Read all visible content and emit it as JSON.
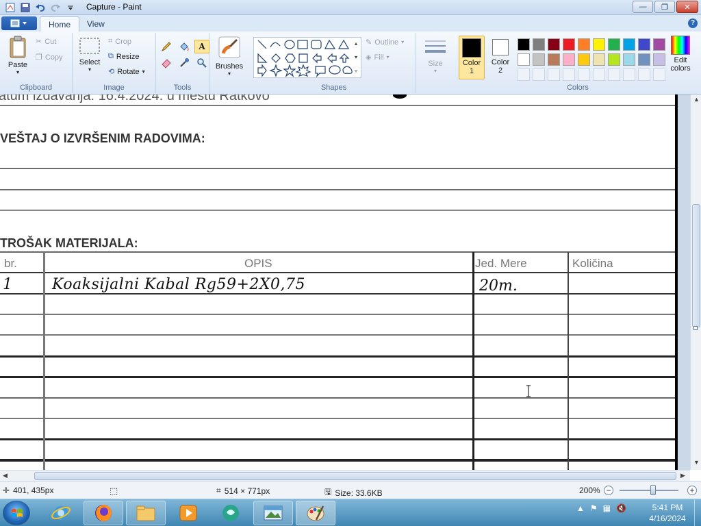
{
  "window": {
    "title": "Capture - Paint",
    "minimize_label": "—",
    "restore_label": "❐",
    "close_label": "✕"
  },
  "tabs": {
    "home": "Home",
    "view": "View"
  },
  "ribbon": {
    "clipboard": {
      "label": "Clipboard",
      "paste": "Paste",
      "cut": "Cut",
      "copy": "Copy"
    },
    "image": {
      "label": "Image",
      "select": "Select",
      "crop": "Crop",
      "resize": "Resize",
      "rotate": "Rotate"
    },
    "tools": {
      "label": "Tools"
    },
    "brushes": {
      "label": "Brushes"
    },
    "shapes": {
      "label": "Shapes",
      "outline": "Outline",
      "fill": "Fill"
    },
    "size": {
      "label": "Size"
    },
    "colors": {
      "label": "Colors",
      "color1": "Color",
      "color1_num": "1",
      "color2": "Color",
      "color2_num": "2",
      "edit": "Edit",
      "edit2": "colors",
      "palette_row1": [
        "#000000",
        "#7f7f7f",
        "#880015",
        "#ed1c24",
        "#ff7f27",
        "#fff200",
        "#22b14c",
        "#00a2e8",
        "#3f48cc",
        "#a349a4"
      ],
      "palette_row2": [
        "#ffffff",
        "#c3c3c3",
        "#b97a57",
        "#ffaec9",
        "#ffc90e",
        "#efe4b0",
        "#b5e61d",
        "#99d9ea",
        "#7092be",
        "#c8bfe7"
      ]
    }
  },
  "document": {
    "partial_top_line": "atum izdavanja: 16.4.2024. u mestu Ratkovo",
    "section1_heading": "VEŠTAJ O IZVRŠENIM RADOVIMA:",
    "section2_heading": "TROŠAK MATERIJALA:",
    "table": {
      "headers": [
        "br.",
        "OPIS",
        "Jed. Mere",
        "Količina"
      ],
      "rows": [
        [
          "1",
          "Koaksijalni Kabal Rg59+2X0,75",
          "20m.",
          ""
        ]
      ]
    }
  },
  "status": {
    "cursor_pos": "401, 435px",
    "image_size": "514 × 771px",
    "file_size": "Size: 33.6KB",
    "zoom": "200%"
  },
  "taskbar": {
    "time": "5:41 PM",
    "date": "4/16/2024"
  }
}
